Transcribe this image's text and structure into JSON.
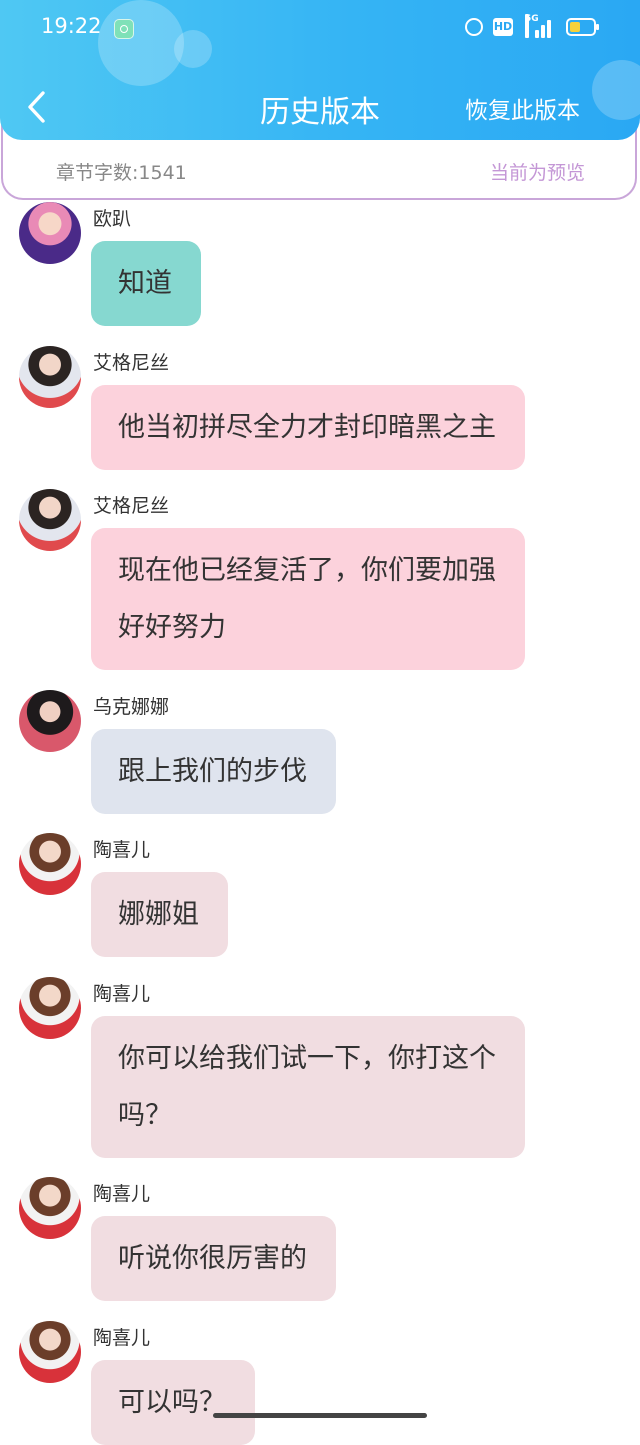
{
  "status_bar": {
    "time": "19:22",
    "network_label": "5G",
    "hd_label": "HD",
    "icons": [
      "notification-icon",
      "alarm-icon",
      "hd-icon",
      "signal-icon",
      "battery-icon"
    ]
  },
  "header": {
    "title": "历史版本",
    "restore_label": "恢复此版本",
    "back_icon": "chevron-left-icon"
  },
  "info_bar": {
    "word_count": "章节字数:1541",
    "preview_label": "当前为预览"
  },
  "colors": {
    "header_gradient_start": "#4fc8f3",
    "header_gradient_end": "#2aa8f3",
    "bubble_green": "#86d8d0",
    "bubble_pink": "#fcd2dc",
    "bubble_gray": "#dfe4ee",
    "bubble_rose": "#f1dde1",
    "accent_purple": "#c497d6"
  },
  "messages": [
    {
      "sender": "欧趴",
      "lines": [
        "知道"
      ],
      "color": "#86d8d0"
    },
    {
      "sender": "艾格尼丝",
      "lines": [
        "他当初拼尽全力才封印暗黑之主"
      ],
      "color": "#fcd2dc"
    },
    {
      "sender": "艾格尼丝",
      "lines": [
        "现在他已经复活了，你们要加强",
        "好好努力"
      ],
      "color": "#fcd2dc"
    },
    {
      "sender": "乌克娜娜",
      "lines": [
        "跟上我们的步伐"
      ],
      "color": "#dfe4ee"
    },
    {
      "sender": "陶喜儿",
      "lines": [
        "娜娜姐"
      ],
      "color": "#f1dde1"
    },
    {
      "sender": "陶喜儿",
      "lines": [
        "你可以给我们试一下，你打这个",
        "吗？"
      ],
      "color": "#f1dde1"
    },
    {
      "sender": "陶喜儿",
      "lines": [
        "听说你很厉害的"
      ],
      "color": "#f1dde1"
    },
    {
      "sender": "陶喜儿",
      "lines": [
        "可以吗？"
      ],
      "color": "#f1dde1"
    }
  ]
}
